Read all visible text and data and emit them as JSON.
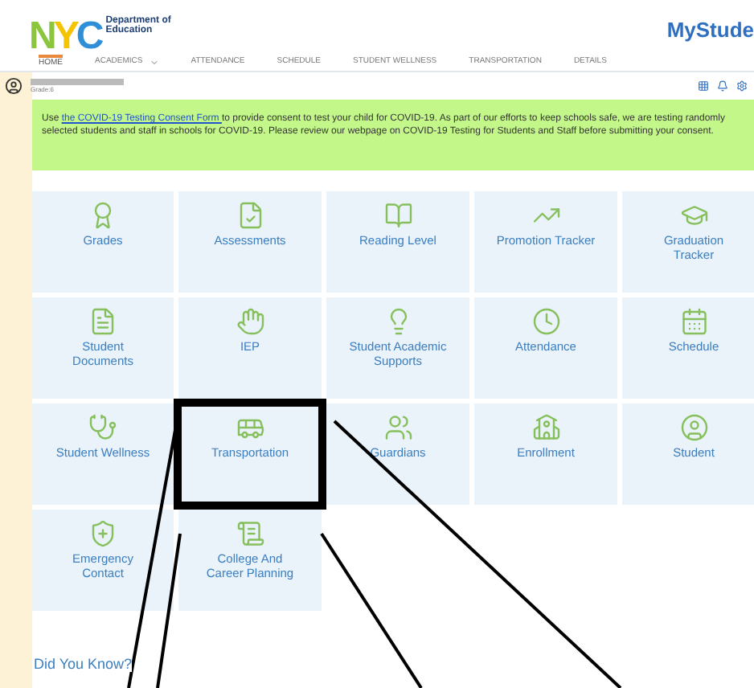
{
  "header": {
    "logo": "NYC",
    "department": [
      "Department of",
      "Education"
    ],
    "title": "MyStude"
  },
  "nav": [
    {
      "label": "HOME",
      "selected": true
    },
    {
      "label": "ACADEMICS",
      "selected": false,
      "dropdown": true
    },
    {
      "label": "ATTENDANCE",
      "selected": false
    },
    {
      "label": "SCHEDULE",
      "selected": false
    },
    {
      "label": "STUDENT WELLNESS",
      "selected": false
    },
    {
      "label": "TRANSPORTATION",
      "selected": false
    },
    {
      "label": "DETAILS",
      "selected": false
    }
  ],
  "student": {
    "grade": "Grade:6"
  },
  "banner": {
    "before": "Use ",
    "link": "the COVID-19 Testing Consent Form ",
    "after": "to provide consent to test your child for COVID-19. As part of our efforts to keep schools safe, we are testing randomly selected students and staff in schools for COVID-19. Please review our webpage on COVID-19 Testing for Students and Staff before submitting your consent."
  },
  "tiles": [
    {
      "label": "Grades",
      "highlighted": false
    },
    {
      "label": "Assessments",
      "highlighted": false
    },
    {
      "label": "Reading Level",
      "highlighted": false
    },
    {
      "label": "Promotion Tracker",
      "highlighted": false
    },
    {
      "label": "Graduation Tracker",
      "highlighted": false
    },
    {
      "label": "Student Documents",
      "highlighted": false
    },
    {
      "label": "IEP",
      "highlighted": false
    },
    {
      "label": "Student Academic Supports",
      "highlighted": false
    },
    {
      "label": "Attendance",
      "highlighted": false
    },
    {
      "label": "Schedule",
      "highlighted": false
    },
    {
      "label": "Student Wellness",
      "highlighted": false
    },
    {
      "label": "Transportation",
      "highlighted": true
    },
    {
      "label": "Guardians",
      "highlighted": false
    },
    {
      "label": "Enrollment",
      "highlighted": false
    },
    {
      "label": "Student",
      "highlighted": false
    },
    {
      "label": "Emergency Contact",
      "highlighted": false
    },
    {
      "label": "College And Career Planning",
      "highlighted": false
    }
  ],
  "did_you_know": "Did You Know?"
}
